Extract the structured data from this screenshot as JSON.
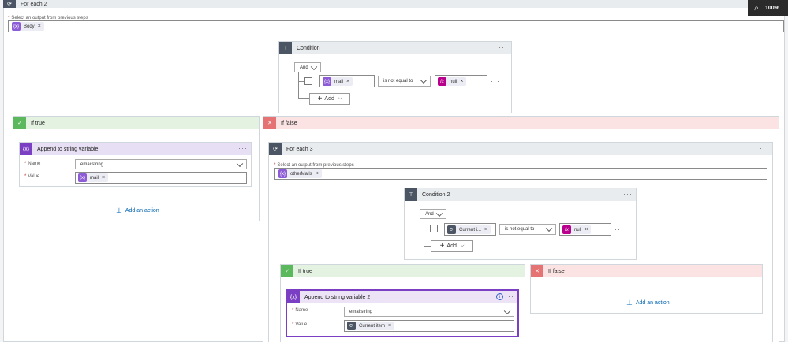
{
  "foreach2": {
    "title": "For each 2",
    "select_label": "Select an output from previous steps",
    "token": "Body"
  },
  "zoom": {
    "level": "100%"
  },
  "condition1": {
    "title": "Condition",
    "group_op": "And",
    "left_token": "mail",
    "operator": "is not equal to",
    "right_token": "null",
    "add_label": "Add"
  },
  "if_true_1": {
    "title": "If true"
  },
  "append1": {
    "title": "Append to string variable",
    "name_label": "Name",
    "name_value": "emailstring",
    "value_label": "Value",
    "value_token": "mail",
    "add_action": "Add an action"
  },
  "if_false_1": {
    "title": "If false"
  },
  "foreach3": {
    "title": "For each 3",
    "select_label": "Select an output from previous steps",
    "token": "otherMails"
  },
  "condition2": {
    "title": "Condition 2",
    "group_op": "And",
    "left_token": "Current i...",
    "operator": "is not equal to",
    "right_token": "null",
    "add_label": "Add"
  },
  "if_true_2": {
    "title": "If true"
  },
  "append2": {
    "title": "Append to string variable 2",
    "name_label": "Name",
    "name_value": "emailstring",
    "value_label": "Value",
    "value_token": "Current item"
  },
  "if_false_2": {
    "title": "If false",
    "add_action": "Add an action"
  },
  "colors": {
    "variable": "#7b3fc4",
    "variable_token": "#8e5bd6",
    "control": "#4b5563",
    "expression": "#b8008c",
    "true_green": "#5cb85c",
    "false_red": "#e57373",
    "link": "#0063b1"
  }
}
